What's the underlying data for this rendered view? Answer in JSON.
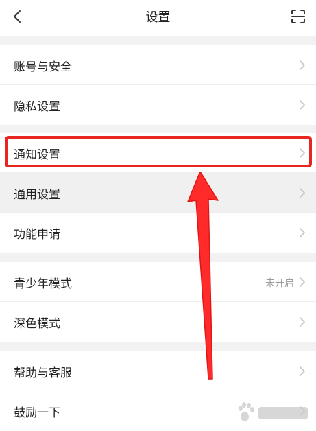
{
  "header": {
    "title": "设置",
    "back_icon": "chevron-left-icon",
    "scan_icon": "scan-icon"
  },
  "groups": [
    {
      "items": [
        {
          "label": "账号与安全"
        },
        {
          "label": "隐私设置"
        }
      ]
    },
    {
      "items": [
        {
          "label": "通知设置"
        },
        {
          "label": "通用设置"
        },
        {
          "label": "功能申请"
        }
      ]
    },
    {
      "items": [
        {
          "label": "青少年模式",
          "value": "未开启"
        },
        {
          "label": "深色模式"
        }
      ]
    },
    {
      "items": [
        {
          "label": "帮助与客服"
        },
        {
          "label": "鼓励一下"
        }
      ]
    }
  ],
  "annotation": {
    "highlight_color": "#e8261f",
    "arrow_color": "#ff2b2b",
    "target": "通知设置"
  },
  "watermark": {
    "logo_icon": "baidu-paw-logo"
  }
}
